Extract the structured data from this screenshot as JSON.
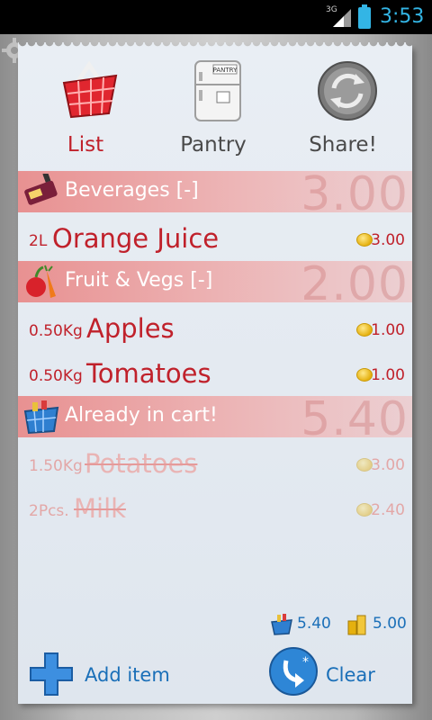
{
  "status_bar": {
    "network": "3G",
    "time": "3:53"
  },
  "nav": {
    "list_label": "List",
    "pantry_label": "Pantry",
    "share_label": "Share!",
    "active": "List"
  },
  "sections": [
    {
      "title": "Beverages [-]",
      "total": "3.00",
      "icon": "beverages-icon",
      "items": [
        {
          "qty": "2L",
          "name": "Orange Juice",
          "price": "3.00"
        }
      ]
    },
    {
      "title": "Fruit & Vegs [-]",
      "total": "2.00",
      "icon": "fruit-vegs-icon",
      "items": [
        {
          "qty": "0.50Kg",
          "name": "Apples",
          "price": "1.00"
        },
        {
          "qty": "0.50Kg",
          "name": "Tomatoes",
          "price": "1.00"
        }
      ]
    },
    {
      "title": "Already in cart!",
      "total": "5.40",
      "icon": "cart-basket-icon",
      "items": [
        {
          "qty": "1.50Kg",
          "name": "Potatoes",
          "price": "3.00"
        },
        {
          "qty": "2Pcs.",
          "name": "Milk",
          "price": "2.40"
        }
      ]
    }
  ],
  "totals": {
    "in_cart": "5.40",
    "total": "5.00"
  },
  "actions": {
    "add_label": "Add item",
    "clear_label": "Clear"
  },
  "colors": {
    "accent_red": "#c0212b",
    "accent_blue": "#1a6fb8",
    "section_band": "#e88c8c"
  }
}
